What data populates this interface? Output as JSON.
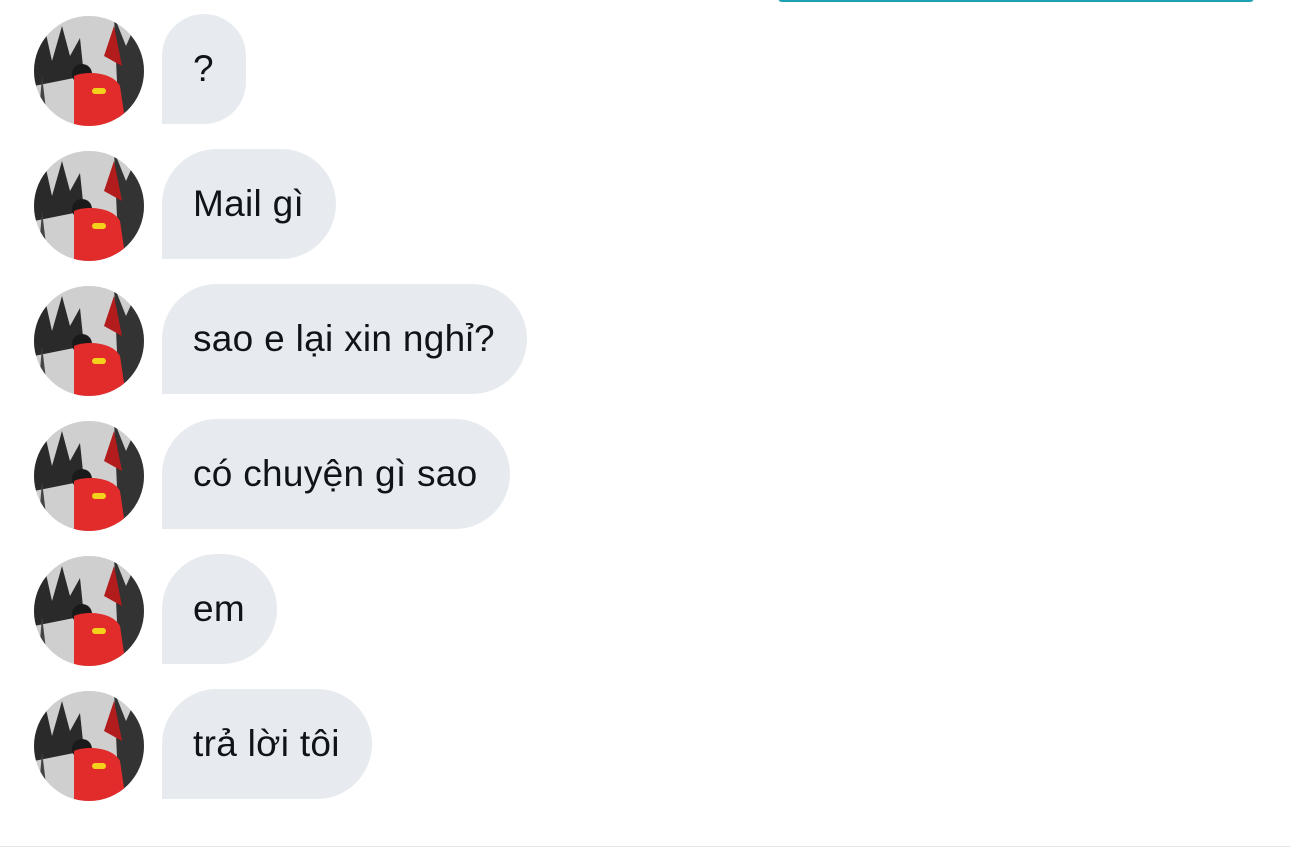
{
  "conversation": {
    "messages": [
      {
        "text": "?"
      },
      {
        "text": "Mail gì"
      },
      {
        "text": "sao e lại xin nghỉ?"
      },
      {
        "text": "có chuyện gì sao"
      },
      {
        "text": "em"
      },
      {
        "text": "trả lời tôi"
      }
    ]
  },
  "colors": {
    "bubble_background": "#e7ebef",
    "text": "#0f1419",
    "accent": "#1da1b2"
  }
}
